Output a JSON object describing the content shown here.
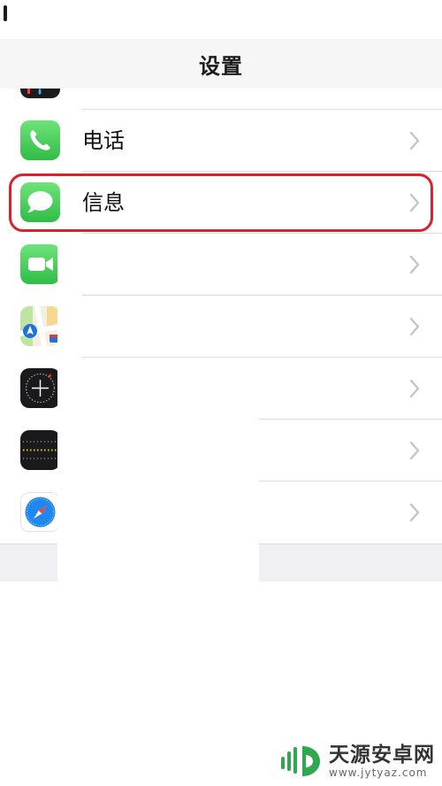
{
  "nav": {
    "title": "设置"
  },
  "rows": [
    {
      "id": "partial",
      "label": "",
      "icon": "partial-app-icon"
    },
    {
      "id": "phone",
      "label": "电话",
      "icon": "phone-icon"
    },
    {
      "id": "messages",
      "label": "信息",
      "icon": "messages-icon"
    },
    {
      "id": "facetime",
      "label": "",
      "icon": "facetime-icon"
    },
    {
      "id": "maps",
      "label": "",
      "icon": "maps-icon"
    },
    {
      "id": "compass",
      "label": "",
      "icon": "compass-icon"
    },
    {
      "id": "measure",
      "label": "",
      "icon": "measure-icon"
    },
    {
      "id": "safari",
      "label": "",
      "icon": "safari-icon"
    }
  ],
  "watermark": {
    "title": "天源安卓网",
    "url": "www.jytyaz.com"
  },
  "colors": {
    "highlight": "#d6232e",
    "phone_green": "#4cd964",
    "safari_blue": "#1e88f0",
    "watermark_green": "#2fa84f"
  }
}
